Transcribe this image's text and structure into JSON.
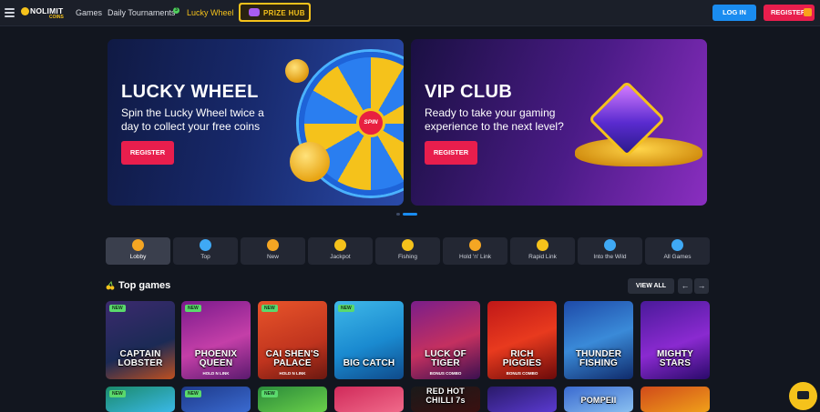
{
  "header": {
    "logo_text": "NOLIMIT",
    "logo_sub": "COINS",
    "nav": [
      {
        "label": "Games"
      },
      {
        "label": "Daily Tournaments",
        "badge": "3"
      },
      {
        "label": "Lucky Wheel"
      }
    ],
    "prize_hub_label": "PRIZE HUB",
    "login_label": "LOG IN",
    "register_label": "REGISTER"
  },
  "banners": [
    {
      "title": "LUCKY WHEEL",
      "subtitle": "Spin the Lucky Wheel twice a day to collect your free coins",
      "button": "REGISTER",
      "wheel_label": "SPIN"
    },
    {
      "title": "VIP CLUB",
      "subtitle": "Ready to take your gaming experience to the next level?",
      "button": "REGISTER"
    }
  ],
  "categories": [
    {
      "label": "Lobby",
      "icon": "lobby-icon",
      "color": "#f5a623"
    },
    {
      "label": "Top",
      "icon": "top-icon",
      "color": "#3fa9f5"
    },
    {
      "label": "New",
      "icon": "new-icon",
      "color": "#f5a623"
    },
    {
      "label": "Jackpot",
      "icon": "trophy-icon",
      "color": "#f5c21b"
    },
    {
      "label": "Fishing",
      "icon": "fish-icon",
      "color": "#f5c21b"
    },
    {
      "label": "Hold 'n' Link",
      "icon": "hold-link-icon",
      "color": "#f5a623"
    },
    {
      "label": "Rapid Link",
      "icon": "flag-icon",
      "color": "#f5c21b"
    },
    {
      "label": "Into the Wild",
      "icon": "paw-icon",
      "color": "#3fa9f5"
    },
    {
      "label": "All Games",
      "icon": "gamepad-icon",
      "color": "#3fa9f5"
    }
  ],
  "top_games": {
    "title": "Top games",
    "view_all": "VIEW ALL",
    "prev": "←",
    "next": "→",
    "row1": [
      {
        "name": "CAPTAIN LOBSTER",
        "sub": "",
        "new": "NEW"
      },
      {
        "name": "PHOENIX QUEEN",
        "sub": "HOLD N LINK",
        "new": "NEW"
      },
      {
        "name": "CAI SHEN'S PALACE",
        "sub": "HOLD N LINK",
        "new": "NEW"
      },
      {
        "name": "BIG CATCH",
        "sub": "",
        "new": "NEW"
      },
      {
        "name": "LUCK OF TIGER",
        "sub": "BONUS COMBO",
        "new": ""
      },
      {
        "name": "RICH PIGGIES",
        "sub": "BONUS COMBO",
        "new": ""
      },
      {
        "name": "THUNDER FISHING",
        "sub": "",
        "new": ""
      },
      {
        "name": "MIGHTY STARS",
        "sub": "",
        "new": ""
      }
    ],
    "row2": [
      {
        "name": "",
        "new": "NEW"
      },
      {
        "name": "",
        "new": "NEW"
      },
      {
        "name": "",
        "new": "NEW"
      },
      {
        "name": "",
        "new": ""
      },
      {
        "name": "RED HOT CHILLI 7s",
        "new": ""
      },
      {
        "name": "",
        "new": ""
      },
      {
        "name": "POMPEII",
        "new": ""
      },
      {
        "name": "",
        "new": ""
      }
    ]
  }
}
